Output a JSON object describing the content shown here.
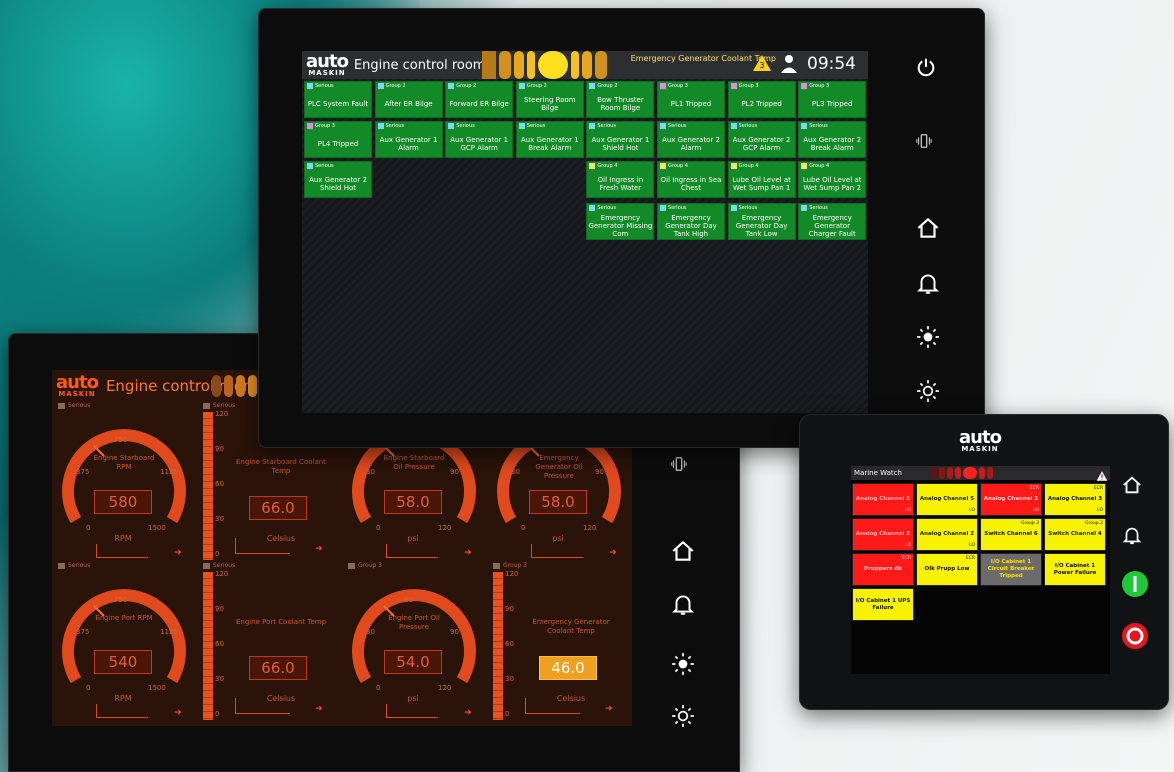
{
  "brand": {
    "logo_top": "auto",
    "logo_bottom": "MASKIN"
  },
  "left_panel": {
    "title": "Engine control room",
    "gauges": [
      {
        "group": "Serious",
        "label": "Engine Starboard RPM",
        "value": "580",
        "unit": "RPM",
        "ticks": [
          "750",
          "375",
          "1125",
          "0",
          "1500"
        ]
      },
      {
        "group": "Serious",
        "label": "Engine Starboard Coolant Temp",
        "value": "66.0",
        "unit": "Celsius",
        "bar_ticks": [
          "120",
          "90",
          "60",
          "30",
          "0"
        ]
      },
      {
        "group": "Serious",
        "label": "Engine Starboard Oil Pressure",
        "value": "58.0",
        "unit": "psi",
        "ticks": [
          "60",
          "30",
          "90",
          "0",
          "120"
        ]
      },
      {
        "group": "Serious",
        "label": "Emergency Generator Oil Pressure",
        "value": "58.0",
        "unit": "psi",
        "ticks": [
          "60",
          "30",
          "90",
          "0",
          "120"
        ]
      },
      {
        "group": "Serious",
        "label": "Engine Port RPM",
        "value": "540",
        "unit": "RPM",
        "ticks": [
          "750",
          "375",
          "1125",
          "0",
          "1500"
        ]
      },
      {
        "group": "Serious",
        "label": "Engine Port Coolant Temp",
        "value": "66.0",
        "unit": "Celsius",
        "bar_ticks": [
          "120",
          "90",
          "60",
          "30",
          "0"
        ]
      },
      {
        "group": "Group 3",
        "label": "Engine Port Oil Pressure",
        "value": "54.0",
        "unit": "psi",
        "ticks": [
          "60",
          "30",
          "90",
          "0",
          "120"
        ]
      },
      {
        "group": "Group 3",
        "label": "Emergency Generator Coolant Temp",
        "value": "46.0",
        "unit": "Celsius",
        "bar_ticks": [
          "120",
          "90",
          "60",
          "30",
          "0"
        ]
      }
    ]
  },
  "top_panel": {
    "title": "Engine control room",
    "alarm_text": "Emergency Generator Coolant Temp",
    "alarm_count": "3",
    "clock": "09:54",
    "tiles": [
      {
        "group": "Serious",
        "color": "#7fd6f2",
        "text": "PLC System Fault"
      },
      {
        "group": "Group 2",
        "color": "#7fd6f2",
        "text": "After ER Bilge"
      },
      {
        "group": "Group 2",
        "color": "#7fd6f2",
        "text": "Forward ER Bilge"
      },
      {
        "group": "Group 2",
        "color": "#7fd6f2",
        "text": "Steering Room Bilge"
      },
      {
        "group": "Group 2",
        "color": "#7fd6f2",
        "text": "Bow Thruster Room Bilge"
      },
      {
        "group": "Group 3",
        "color": "#e08ae0",
        "text": "PL1 Tripped"
      },
      {
        "group": "Group 3",
        "color": "#e08ae0",
        "text": "PL2 Tripped"
      },
      {
        "group": "Group 3",
        "color": "#e08ae0",
        "text": "PL3 Tripped"
      },
      {
        "group": "Group 3",
        "color": "#e08ae0",
        "text": "PL4 Tripped"
      },
      {
        "group": "Serious",
        "color": "#7fd6f2",
        "text": "Aux Generator 1 Alarm"
      },
      {
        "group": "Serious",
        "color": "#7fd6f2",
        "text": "Aux Generator 1 GCP Alarm"
      },
      {
        "group": "Serious",
        "color": "#7fd6f2",
        "text": "Aux Generator 1 Break Alarm"
      },
      {
        "group": "Serious",
        "color": "#7fd6f2",
        "text": "Aux Generator 1 Shield Hot"
      },
      {
        "group": "Serious",
        "color": "#7fd6f2",
        "text": "Aux Generator 2 Alarm"
      },
      {
        "group": "Serious",
        "color": "#7fd6f2",
        "text": "Aux Generator 2 GCP Alarm"
      },
      {
        "group": "Serious",
        "color": "#7fd6f2",
        "text": "Aux Generator 2 Break Alarm"
      },
      {
        "group": "Serious",
        "color": "#7fd6f2",
        "text": "Aux Generator 2 Shield Hot"
      },
      {
        "group": "Group 4",
        "color": "#f4e27a",
        "text": "Oil Ingress in Fresh Water"
      },
      {
        "group": "Group 4",
        "color": "#f4e27a",
        "text": "Oil Ingress in Sea Chest"
      },
      {
        "group": "Group 4",
        "color": "#f4e27a",
        "text": "Lube Oil Level at Wet Sump Pan 1"
      },
      {
        "group": "Group 4",
        "color": "#f4e27a",
        "text": "Lube Oil Level at Wet Sump Pan 2"
      },
      {
        "group": "Serious",
        "color": "#7fd6f2",
        "text": "Emergency Generator Missing Com"
      },
      {
        "group": "Serious",
        "color": "#7fd6f2",
        "text": "Emergency Generator Day Tank High"
      },
      {
        "group": "Serious",
        "color": "#7fd6f2",
        "text": "Emergency Generator Day Tank Low"
      },
      {
        "group": "Serious",
        "color": "#7fd6f2",
        "text": "Emergency Generator Charger Fault"
      }
    ]
  },
  "right_panel": {
    "title": "Marine Watch",
    "tiles": [
      {
        "text": "Analog Channel 5",
        "bg": "#ff1a1a",
        "fg": "#ffb0b0",
        "corner": "",
        "lo": "LO"
      },
      {
        "text": "Analog Channel 5",
        "bg": "#f7f200",
        "fg": "#222",
        "corner": "",
        "lo": "LO"
      },
      {
        "text": "Analog Channel 2",
        "bg": "#ff1a1a",
        "fg": "#ffd0d0",
        "corner": "ECR",
        "lo": "LO"
      },
      {
        "text": "Analog Channel 3",
        "bg": "#f7f200",
        "fg": "#111",
        "corner": "ECR",
        "lo": "LO"
      },
      {
        "text": "Analog Channel 2",
        "bg": "#ff1a1a",
        "fg": "#ffb0b0",
        "corner": "",
        "lo": "LO"
      },
      {
        "text": "Analog Channel 2",
        "bg": "#f7f200",
        "fg": "#222",
        "corner": "",
        "lo": "LO"
      },
      {
        "text": "Switch Channel 6",
        "bg": "#f7f200",
        "fg": "#111",
        "corner": "Group 3",
        "lo": ""
      },
      {
        "text": "Switch Channel 4",
        "bg": "#f7f200",
        "fg": "#222",
        "corner": "Group 2",
        "lo": ""
      },
      {
        "text": "Pruppers dk",
        "bg": "#ff1a1a",
        "fg": "#ffd0d0",
        "corner": "ECR",
        "lo": ""
      },
      {
        "text": "Olk Prupp Low",
        "bg": "#f7f200",
        "fg": "#111",
        "corner": "ECR",
        "lo": ""
      },
      {
        "text": "I/O Cabinet 1 Circuit Breaker Tripped",
        "bg": "#6b6b6b",
        "fg": "#ffe000",
        "corner": "",
        "lo": ""
      },
      {
        "text": "I/O Cabinet 1 Power Failure",
        "bg": "#f7f200",
        "fg": "#111",
        "corner": "",
        "lo": ""
      },
      {
        "text": "I/O Cabinet 1 UPS Failure",
        "bg": "#f7f200",
        "fg": "#111",
        "corner": "",
        "lo": ""
      }
    ]
  }
}
